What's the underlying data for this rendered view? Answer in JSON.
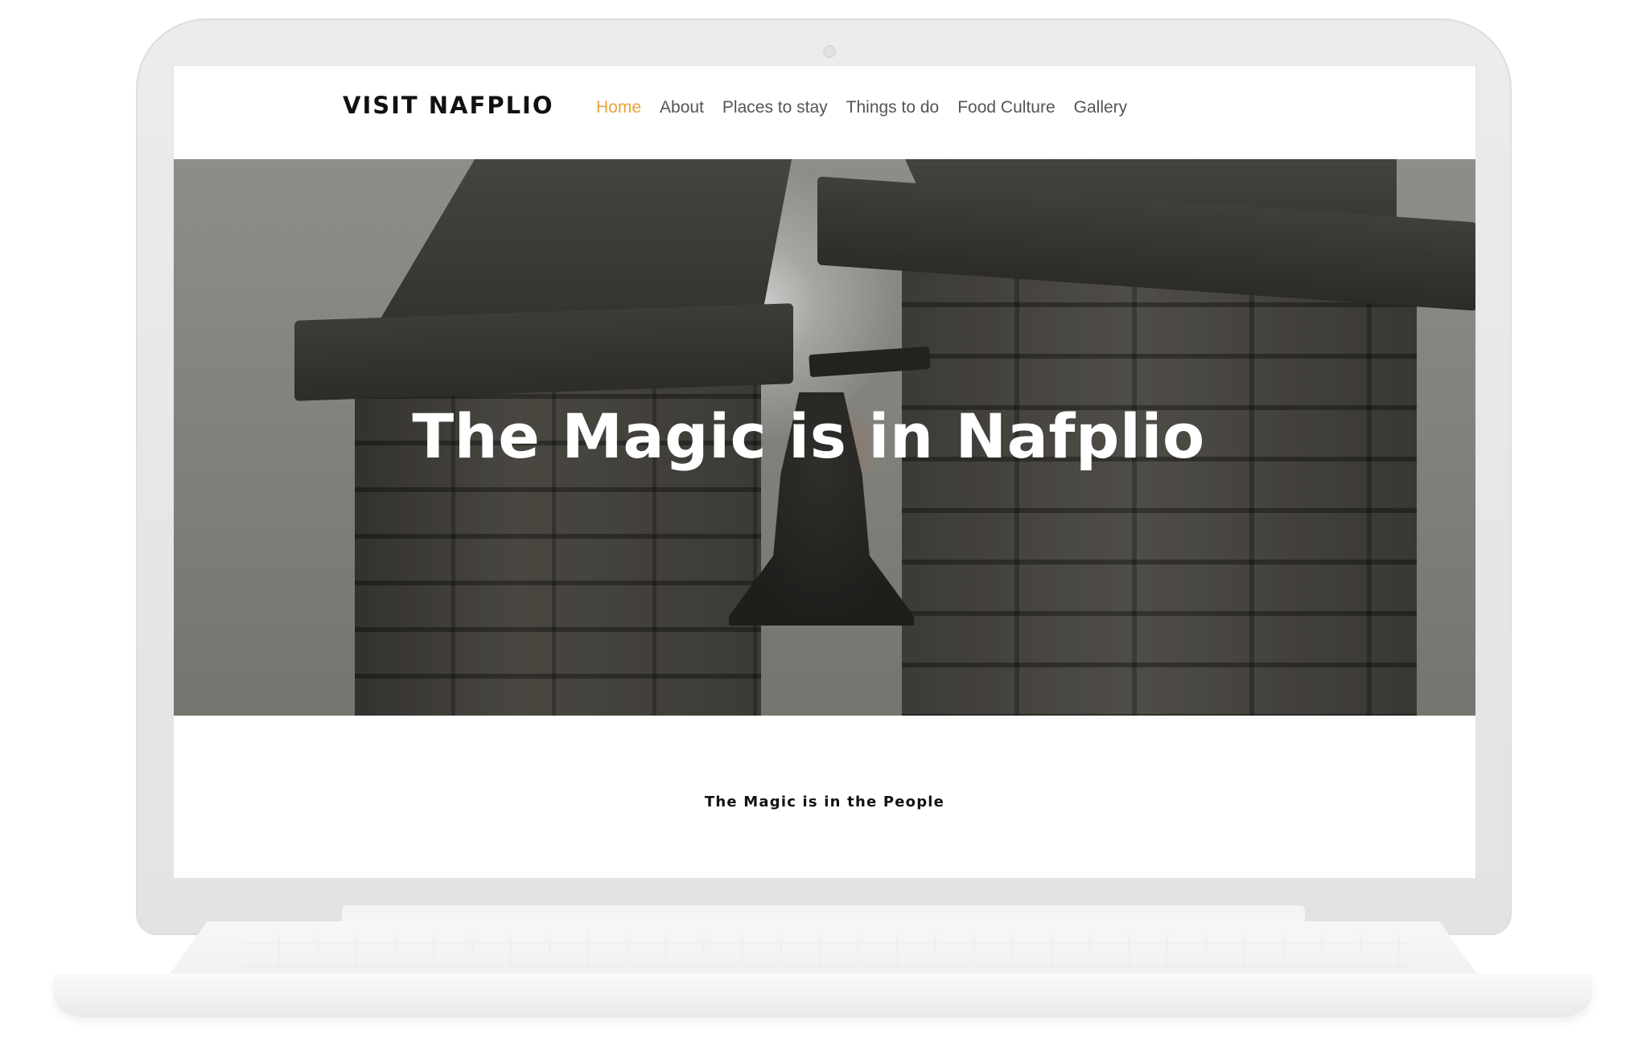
{
  "site": {
    "brand": "VISIT NAFPLIO"
  },
  "nav": {
    "items": [
      {
        "label": "Home",
        "active": true
      },
      {
        "label": "About"
      },
      {
        "label": "Places to stay"
      },
      {
        "label": "Things to do"
      },
      {
        "label": "Food Culture"
      },
      {
        "label": "Gallery"
      }
    ],
    "active_color": "#e8a23b"
  },
  "hero": {
    "title": "The Magic is in Nafplio"
  },
  "section": {
    "tagline": "The Magic is in the People"
  }
}
